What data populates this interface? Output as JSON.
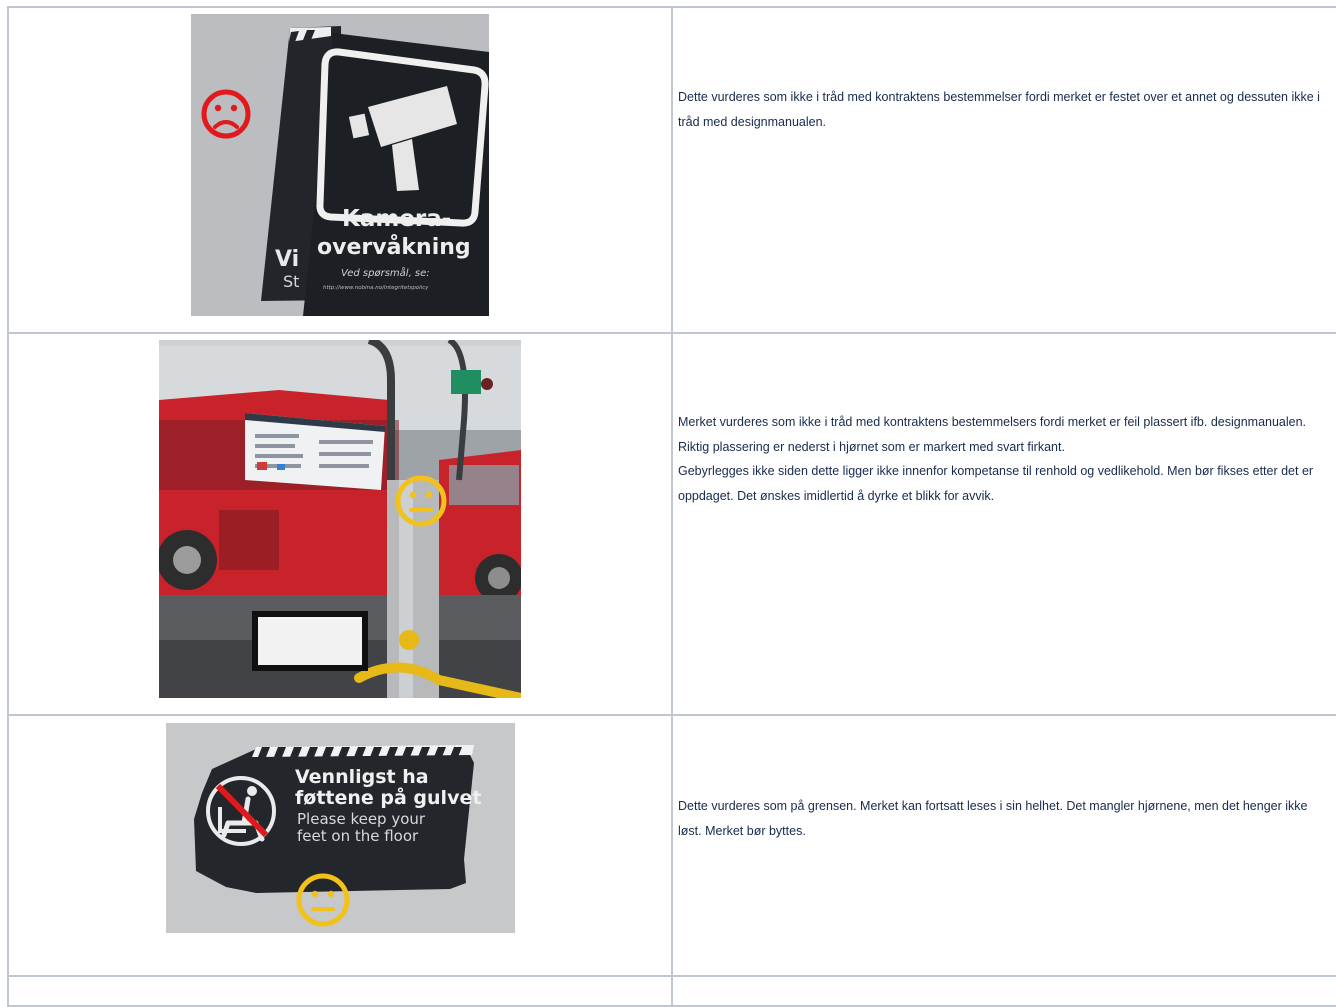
{
  "rows": [
    {
      "image": {
        "sign_title_1": "Kamera-",
        "sign_title_2": "overvåkning",
        "sign_question": "Ved spørsmål, se:",
        "sign_url": "http://www.nobina.no/integritetspolicy",
        "behind_text_1": "Vi",
        "behind_text_2": "St",
        "rating": "sad",
        "rating_color": "#e0191c"
      },
      "paragraphs": [
        "Dette vurderes som ikke i tråd med kontraktens bestemmelser fordi merket er festet over et annet og dessuten ikke i tråd med designmanualen."
      ]
    },
    {
      "image": {
        "rating": "neutral",
        "rating_color": "#f2c21b"
      },
      "paragraphs": [
        "Merket vurderes som ikke i tråd med kontraktens bestemmelsers fordi merket er feil plassert ifb. designmanualen. Riktig plassering er nederst i hjørnet som er markert med svart firkant.",
        "Gebyrlegges ikke siden dette ligger ikke innenfor kompetanse til renhold og vedlikehold. Men bør fikses etter det er oppdaget. Det ønskes imidlertid å dyrke et blikk for avvik."
      ]
    },
    {
      "image": {
        "sign_no_1": "Vennligst ha",
        "sign_no_2": "føttene på gulvet",
        "sign_en_1": "Please keep your",
        "sign_en_2": "feet on the floor",
        "rating": "neutral",
        "rating_color": "#f2c21b"
      },
      "paragraphs": [
        "Dette vurderes som på grensen. Merket kan fortsatt leses i sin helhet. Det mangler hjørnene, men det henger ikke løst. Merket bør byttes."
      ]
    }
  ]
}
